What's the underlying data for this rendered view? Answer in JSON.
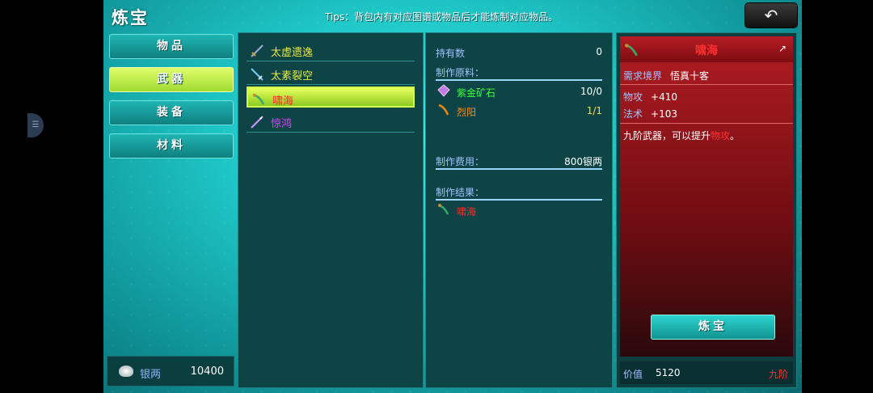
{
  "title": "炼宝",
  "tips": "Tips：背包内有对应图谱或物品后才能炼制对应物品。",
  "back_icon": "↶",
  "side_handle_icon": "☰",
  "tabs": [
    {
      "label": "物品",
      "active": false
    },
    {
      "label": "武器",
      "active": true
    },
    {
      "label": "装备",
      "active": false
    },
    {
      "label": "材料",
      "active": false
    }
  ],
  "money": {
    "label": "银两",
    "value": "10400"
  },
  "items": [
    {
      "name": "太虚遗逸",
      "color": "#e8e84a"
    },
    {
      "name": "太素裂空",
      "color": "#e8e84a"
    },
    {
      "name": "啸海",
      "color": "#ff2a2a"
    },
    {
      "name": "惊鸿",
      "color": "#e040ff"
    }
  ],
  "detail": {
    "owned_label": "持有数",
    "owned_value": "0",
    "materials_label": "制作原料：",
    "materials": [
      {
        "name": "紫金矿石",
        "count": "10/0",
        "name_color": "#3cff3c",
        "count_color": "#ffffff"
      },
      {
        "name": "烈阳",
        "count": "1/1",
        "name_color": "#ff8c1a",
        "count_color": "#f0e040"
      }
    ],
    "cost_label": "制作费用：",
    "cost_value": "800银两",
    "result_label": "制作结果：",
    "result_name": "啸海",
    "result_color": "#ff2a2a"
  },
  "info": {
    "name": "啸海",
    "corner_icon": "↗",
    "realm_label": "需求境界",
    "realm_value": "悟真十客",
    "attack_label": "物攻",
    "attack_value": "+410",
    "magic_label": "法术",
    "magic_value": "+103",
    "desc_prefix": "九阶武器，可以提升",
    "desc_highlight": "物攻",
    "desc_suffix": "。",
    "refine_label": "炼宝",
    "price_label": "价值",
    "price_value": "5120",
    "tier": "九阶"
  }
}
